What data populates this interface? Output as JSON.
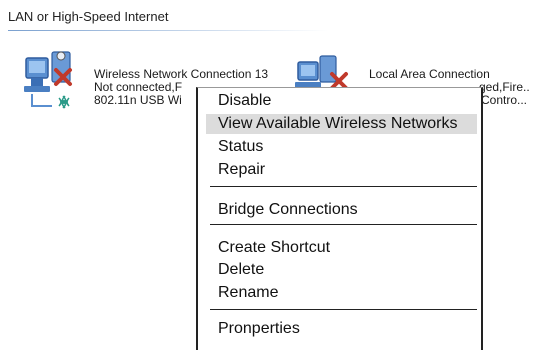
{
  "section": {
    "title": "LAN or High-Speed Internet"
  },
  "connections": [
    {
      "name": "Wireless Network Connection 13",
      "status": "Not connected,F",
      "device": "802.11n USB Wi",
      "icon": "wireless-adapter-disconnected-icon"
    },
    {
      "name": "Local Area Connection",
      "status": "ged,Fire..",
      "device": "Contro...",
      "icon": "lan-adapter-disconnected-icon"
    }
  ],
  "context_menu": {
    "items": [
      "Disable",
      "View Available Wireless Networks",
      "Status",
      "Repair",
      "Bridge Connections",
      "Create Shortcut",
      "Delete",
      "Rename",
      "Pronperties"
    ],
    "selected_index": 1
  },
  "colors": {
    "selection": "#dcdcdc",
    "rule": "#7aa0cf",
    "error_x": "#c0392b"
  }
}
